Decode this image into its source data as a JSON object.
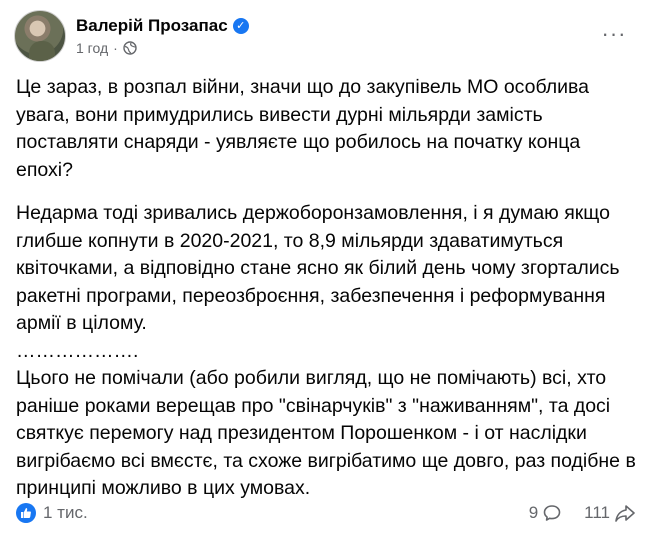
{
  "post": {
    "author": "Валерій Прозапас",
    "time": "1 год",
    "separator": "·",
    "more_label": "···",
    "paragraphs": [
      "Це зараз, в розпал війни, значи що до закупівель МО особлива увага, вони примудрились вивести дурні мільярди замість поставляти снаряди - уявляєте що робилось на початку конца епохі?",
      "Недарма тоді зривались держоборонзамовлення, і я думаю якщо глибше копнути в 2020-2021, то 8,9 мільярди здаватимуться квіточками, а відповідно стане ясно як білий день чому згортались ракетні програми, переозброєння, забезпечення і реформування армії в цілому.",
      "……………….",
      "Цього не помічали (або робили вигляд, що не помічають) всі, хто раніше роками верещав про \"свінарчуків\" з \"наживанням\", та досі святкує перемогу над президентом Порошенком - і от наслідки вигрібаємо всі вмєстє, та схоже вигрібатимо ще довго, раз подібне в принципі можливо в цих умовах."
    ],
    "reactions_count": "1 тис.",
    "comments_count": "9",
    "shares_count": "111"
  },
  "icons": {
    "verified": "verified-badge-icon",
    "globe": "globe-icon",
    "like": "like-reaction-icon",
    "comment": "comment-icon",
    "share": "share-icon"
  },
  "colors": {
    "accent": "#1877f2",
    "secondary_text": "#65676b",
    "primary_text": "#050505"
  }
}
